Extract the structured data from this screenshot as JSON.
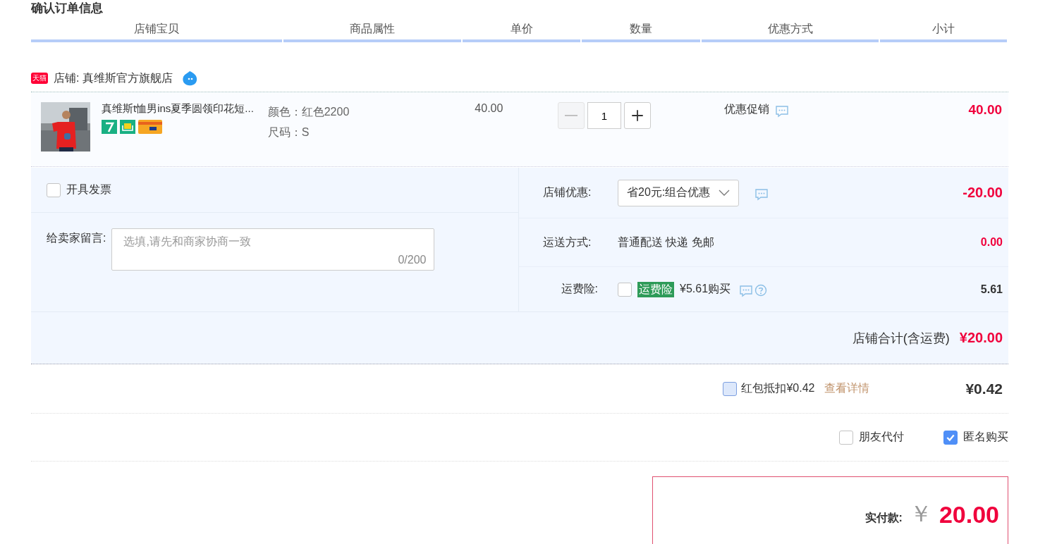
{
  "page_title": "确认订单信息",
  "columns": [
    "店铺宝贝",
    "商品属性",
    "单价",
    "数量",
    "优惠方式",
    "小计"
  ],
  "shop": {
    "badge": "天猫",
    "name": "店铺: 真维斯官方旗舰店"
  },
  "item": {
    "kind": "picture",
    "title": "真维斯t恤男ins夏季圆领印花短...",
    "attributes": [
      "颜色：红色2200",
      "尺码：S"
    ],
    "price": "40.00",
    "quantity": {
      "value": "1",
      "minus_disabled": true
    },
    "promo": "优惠促销",
    "subtotal": "40.00"
  },
  "invoice": {
    "label": "开具发票",
    "checked": false
  },
  "message": {
    "label": "给卖家留言:",
    "placeholder": "选填,请先和商家协商一致",
    "counter": "0/200"
  },
  "discount": {
    "label": "店铺优惠:",
    "option": "省20元:组合优惠",
    "amount": "-20.00"
  },
  "shipping": {
    "label": "运送方式:",
    "method": "普通配送 快递 免邮",
    "amount": "0.00"
  },
  "insurance": {
    "label": "运费险:",
    "checked": false,
    "tag": "运费险",
    "offer": "¥5.61购买",
    "amount": "5.61"
  },
  "shop_total": {
    "label": "店铺合计(含运费)",
    "amount": "¥20.00"
  },
  "red_packet": {
    "label": "红包抵扣¥0.42",
    "checked": false,
    "link": "查看详情",
    "amount": "¥0.42"
  },
  "options": [
    {
      "label": "朋友代付",
      "checked": false
    },
    {
      "label": "匿名购买",
      "checked": true
    }
  ],
  "payment": {
    "label": "实付款:",
    "currency": "￥",
    "amount": "20.00"
  }
}
